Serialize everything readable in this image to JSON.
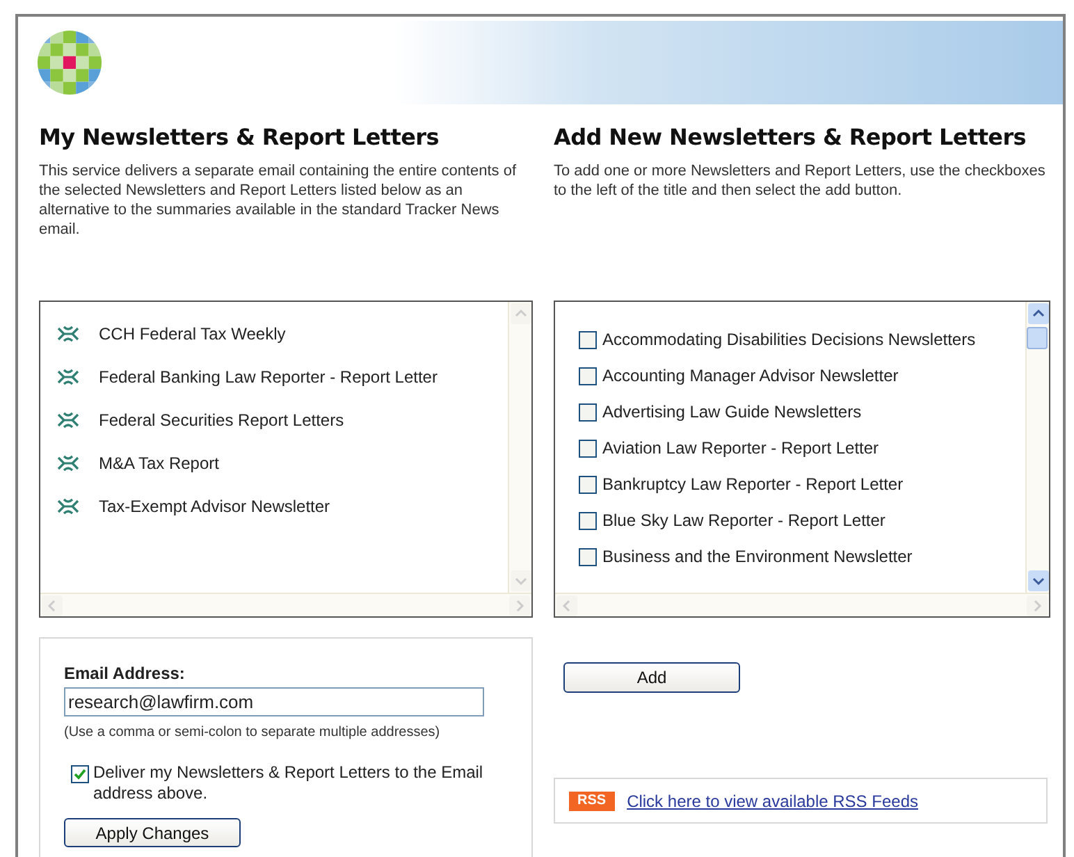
{
  "my_section": {
    "heading": "My Newsletters & Report Letters",
    "description": "This service delivers a separate email containing the entire contents of the selected Newsletters and Report Letters listed below as an alternative to the summaries available in the standard Tracker News email.",
    "items": [
      "CCH Federal Tax Weekly",
      "Federal Banking Law Reporter - Report Letter",
      "Federal Securities Report Letters",
      "M&A Tax Report",
      "Tax-Exempt Advisor Newsletter"
    ]
  },
  "add_section": {
    "heading": "Add New Newsletters & Report Letters",
    "description": "To add one or more Newsletters and Report Letters, use the checkboxes to the left of the title and then select the add button.",
    "items": [
      {
        "label": "Accommodating Disabilities Decisions Newsletters",
        "checked": false
      },
      {
        "label": "Accounting Manager Advisor Newsletter",
        "checked": false
      },
      {
        "label": "Advertising Law Guide Newsletters",
        "checked": false
      },
      {
        "label": "Aviation Law Reporter - Report Letter",
        "checked": false
      },
      {
        "label": "Bankruptcy Law Reporter - Report Letter",
        "checked": false
      },
      {
        "label": "Blue Sky Law Reporter - Report Letter",
        "checked": false
      },
      {
        "label": "Business and the Environment Newsletter",
        "checked": false
      }
    ],
    "add_button": "Add"
  },
  "email_panel": {
    "label": "Email Address:",
    "value": "research@lawfirm.com",
    "hint": "(Use a comma or semi-colon to separate multiple addresses)",
    "deliver": {
      "label": "Deliver my Newsletters & Report Letters to the Email address above.",
      "checked": true
    },
    "apply_button": "Apply Changes"
  },
  "rss": {
    "badge": "RSS",
    "link": "Click here to view available RSS Feeds"
  }
}
